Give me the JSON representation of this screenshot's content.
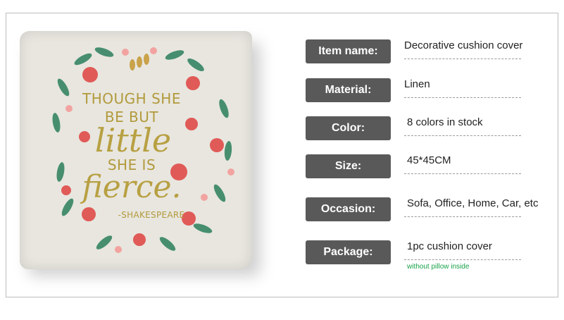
{
  "product": {
    "quote": {
      "line1": "THOUGH SHE",
      "line2": "BE BUT",
      "line3": "little",
      "line4": "SHE IS",
      "line5": "fierce.",
      "line6": "-SHAKESPEARE"
    }
  },
  "specs": [
    {
      "label": "Item name:",
      "value": "Decorative cushion cover"
    },
    {
      "label": "Material:",
      "value": "Linen"
    },
    {
      "label": "Color:",
      "value": "8 colors in stock"
    },
    {
      "label": "Size:",
      "value": "45*45CM"
    },
    {
      "label": "Occasion:",
      "value": "Sofa, Office, Home, Car, etc"
    },
    {
      "label": "Package:",
      "value": "1pc  cushion cover",
      "note": "without pillow inside"
    }
  ],
  "colors": {
    "label_bg": "#595959",
    "label_text": "#ffffff",
    "gold_text": "#b29a3c",
    "note_green": "#1aa24a"
  }
}
